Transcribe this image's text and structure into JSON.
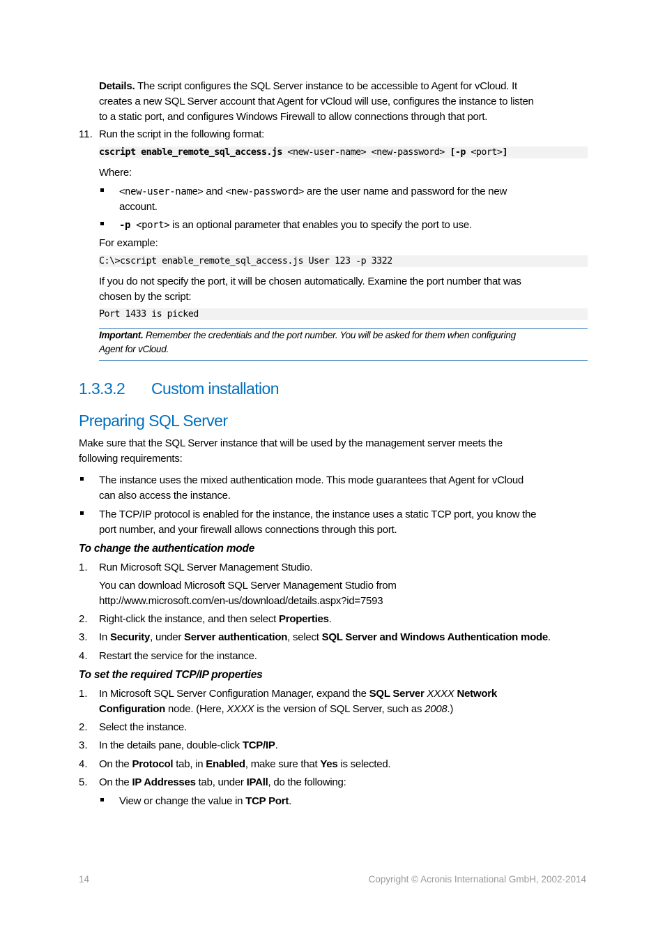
{
  "details_para": {
    "label": "Details.",
    "line1": " The script configures the SQL Server instance to be accessible to Agent for vCloud. It",
    "line2": "creates a new SQL Server account that Agent for vCloud will use, configures the instance to listen",
    "line3": "to a static port, and configures Windows Firewall to allow connections through that port."
  },
  "step11": {
    "number": "11.",
    "text": "Run the script in the following format:",
    "code": {
      "cmd": "cscript enable_remote_sql_access.js",
      "args1": " <new-user-name> <new-password> ",
      "opt_open": "[-p",
      "args2": " <port>",
      "opt_close": "]"
    },
    "where_label": "Where:",
    "bullets": [
      {
        "code1": "<new-user-name>",
        "mid": " and ",
        "code2": "<new-password>",
        "rest_line1": "  are the user name and password for the new",
        "rest_line2": "account."
      },
      {
        "code_bold": "-p",
        "code": " <port>",
        "rest": " is an optional parameter that enables you to specify the port to use."
      }
    ],
    "example_label": "For example:",
    "example_code": "C:\\>cscript enable_remote_sql_access.js User 123 -p 3322",
    "auto_port_line1": "If you do not specify the port, it will be chosen automatically. Examine the port number that was",
    "auto_port_line2": "chosen by the script:",
    "port_output": "Port 1433 is picked",
    "note": {
      "label": "Important.",
      "line1": " Remember the credentials and the port number. You will be asked for them when configuring",
      "line2": "Agent for vCloud."
    }
  },
  "section": {
    "number": "1.3.3.2",
    "title": "Custom installation"
  },
  "subsection": {
    "title": "Preparing SQL Server",
    "intro_line1": "Make sure that the SQL Server instance that will be used by the management server meets the",
    "intro_line2": "following requirements:",
    "requirements": [
      {
        "line1": "The instance uses the mixed authentication mode. This mode guarantees that Agent for vCloud",
        "line2": "can also access the instance."
      },
      {
        "line1": "The TCP/IP protocol is enabled for the instance, the instance uses a static TCP port, you know the",
        "line2": "port number, and your firewall allows connections through this port."
      }
    ]
  },
  "procedure_auth": {
    "title": "To change the authentication mode",
    "steps": [
      {
        "number": "1.",
        "text": "Run Microsoft SQL Server Management Studio.",
        "sub_line1": "You can download Microsoft SQL Server Management Studio from",
        "sub_line2": "http://www.microsoft.com/en-us/download/details.aspx?id=7593"
      },
      {
        "number": "2.",
        "pre": "Right-click the instance, and then select ",
        "bold": "Properties",
        "post": "."
      },
      {
        "number": "3.",
        "pre": "In ",
        "b1": "Security",
        "m1": ", under ",
        "b2": "Server authentication",
        "m2": ", select ",
        "b3": "SQL Server and Windows Authentication mode",
        "post": "."
      },
      {
        "number": "4.",
        "text": "Restart the service for the instance."
      }
    ]
  },
  "procedure_tcp": {
    "title": "To set the required TCP/IP properties",
    "steps": [
      {
        "number": "1.",
        "pre": "In Microsoft SQL Server Configuration Manager, expand the ",
        "b1": "SQL Server",
        "i1": " XXXX",
        "b2": " Network",
        "b3": "Configuration",
        "m1": " node. (Here, ",
        "i2": "XXXX",
        "m2": " is the version of SQL Server, such as ",
        "i3": "2008",
        "post": ".)"
      },
      {
        "number": "2.",
        "text": "Select the instance."
      },
      {
        "number": "3.",
        "pre": "In the details pane, double-click ",
        "bold": "TCP/IP",
        "post": "."
      },
      {
        "number": "4.",
        "pre": "On the ",
        "b1": "Protocol",
        "m1": " tab, in ",
        "b2": "Enabled",
        "m2": ", make sure that ",
        "b3": "Yes",
        "post": " is selected."
      },
      {
        "number": "5.",
        "pre": "On the ",
        "b1": "IP Addresses",
        "m1": " tab, under ",
        "b2": "IPAll",
        "post": ", do the following:",
        "sub_bullet": {
          "pre": "View or change the value in ",
          "bold": "TCP Port",
          "post": "."
        }
      }
    ]
  },
  "footer": {
    "page_number": "14",
    "copyright": "Copyright © Acronis International GmbH, 2002-2014"
  },
  "colors": {
    "heading_blue": "#0070c0",
    "rule_blue": "#2e74b5",
    "code_bg": "#f2f2f2",
    "footer_gray": "#999999"
  }
}
